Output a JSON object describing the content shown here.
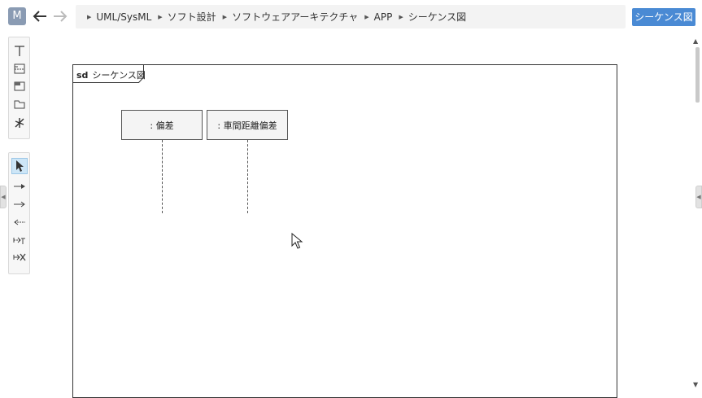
{
  "header": {
    "logo_letter": "M",
    "breadcrumb": [
      "UML/SysML",
      "ソフト設計",
      "ソフトウェアアーキテクチャ",
      "APP",
      "シーケンス図"
    ],
    "diagram_button_label": "シーケンス図"
  },
  "palette_structure": {
    "tools": [
      "lifeline-tool-icon",
      "combined-fragment-icon",
      "interaction-use-icon",
      "frame-tool-icon",
      "actor-tool-icon"
    ]
  },
  "palette_messages": {
    "tools": [
      "select-pointer-icon",
      "sync-message-icon",
      "async-message-icon",
      "reply-message-icon",
      "create-message-icon",
      "destroy-message-icon"
    ],
    "active_tool": "select-pointer-icon"
  },
  "diagram": {
    "frame_kind": "sd",
    "frame_name": "シーケンス図",
    "lifelines": [
      {
        "label": ": 偏差"
      },
      {
        "label": ": 車間距離偏差"
      }
    ]
  },
  "colors": {
    "accent": "#4a8ad4",
    "logo": "#8a9bb3",
    "active_tool": "#cde6f7"
  }
}
